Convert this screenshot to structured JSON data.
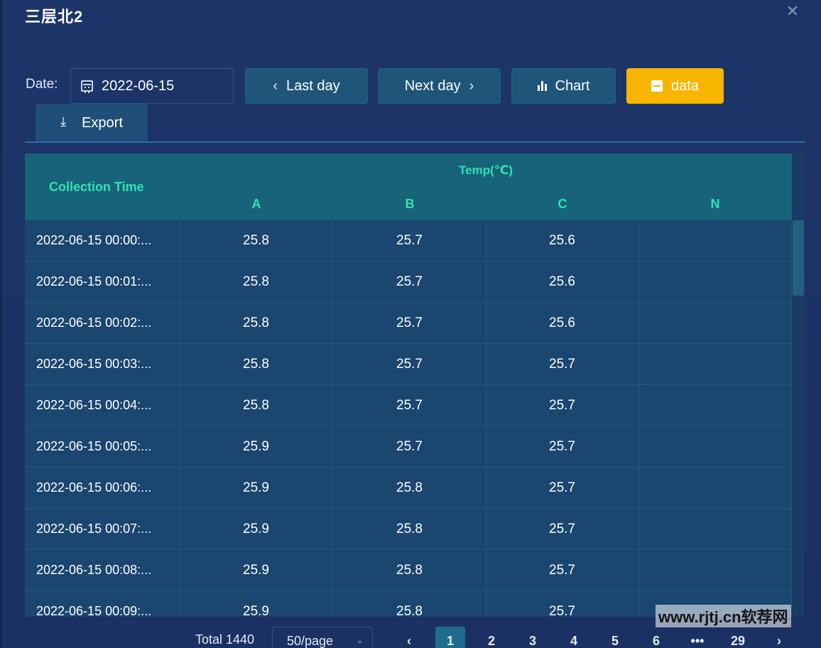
{
  "dialog": {
    "title": "三层北2",
    "close_icon": "close-icon"
  },
  "toolbar": {
    "date_label": "Date:",
    "date_value": "2022-06-15",
    "last_day_label": "Last day",
    "next_day_label": "Next day",
    "chart_label": "Chart",
    "data_label": "data",
    "export_label": "Export",
    "active_color": "#f7b500",
    "button_color": "#1f5579"
  },
  "table": {
    "header": {
      "collection_time": "Collection Time",
      "temp_group": "Temp(℃)",
      "columns": [
        "A",
        "B",
        "C",
        "N"
      ],
      "header_text_color": "#32e0b6"
    },
    "rows": [
      {
        "time": "2022-06-15 00:00:...",
        "A": "25.8",
        "B": "25.7",
        "C": "25.6",
        "N": ""
      },
      {
        "time": "2022-06-15 00:01:...",
        "A": "25.8",
        "B": "25.7",
        "C": "25.6",
        "N": ""
      },
      {
        "time": "2022-06-15 00:02:...",
        "A": "25.8",
        "B": "25.7",
        "C": "25.6",
        "N": ""
      },
      {
        "time": "2022-06-15 00:03:...",
        "A": "25.8",
        "B": "25.7",
        "C": "25.7",
        "N": ""
      },
      {
        "time": "2022-06-15 00:04:...",
        "A": "25.8",
        "B": "25.7",
        "C": "25.7",
        "N": ""
      },
      {
        "time": "2022-06-15 00:05:...",
        "A": "25.9",
        "B": "25.7",
        "C": "25.7",
        "N": ""
      },
      {
        "time": "2022-06-15 00:06:...",
        "A": "25.9",
        "B": "25.8",
        "C": "25.7",
        "N": ""
      },
      {
        "time": "2022-06-15 00:07:...",
        "A": "25.9",
        "B": "25.8",
        "C": "25.7",
        "N": ""
      },
      {
        "time": "2022-06-15 00:08:...",
        "A": "25.9",
        "B": "25.8",
        "C": "25.7",
        "N": ""
      },
      {
        "time": "2022-06-15 00:09:...",
        "A": "25.9",
        "B": "25.8",
        "C": "25.7",
        "N": ""
      }
    ]
  },
  "pagination": {
    "total": "Total 1440",
    "page_size": "50/page",
    "pages": [
      "1",
      "2",
      "3",
      "4",
      "5",
      "6",
      "•••",
      "29"
    ],
    "current_page": "1"
  },
  "watermark": "www.rjtj.cn软荐网"
}
